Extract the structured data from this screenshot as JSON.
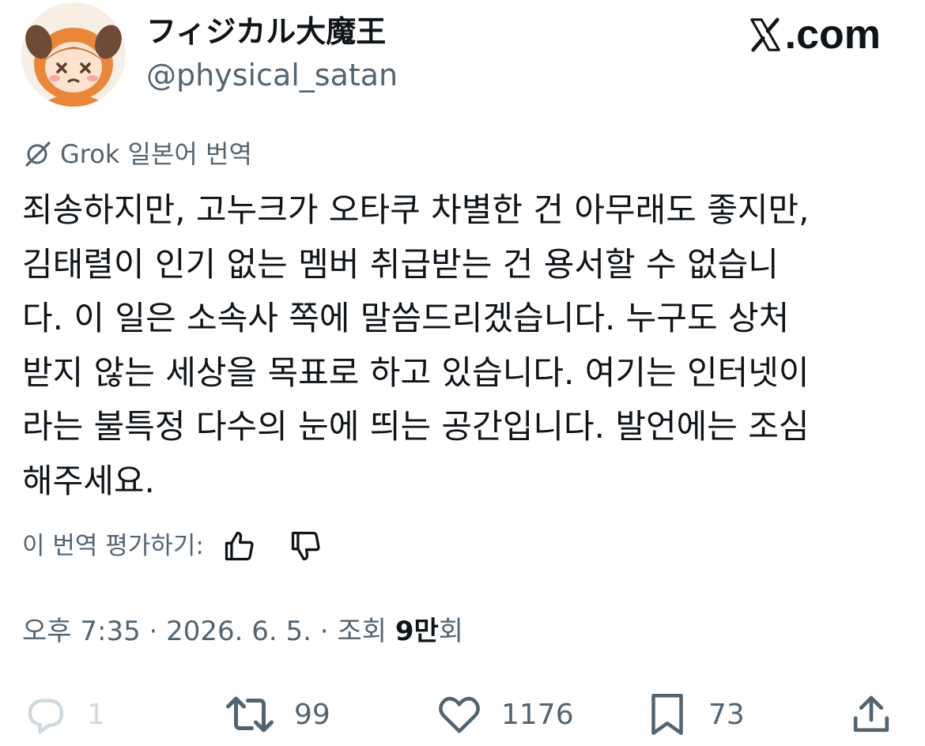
{
  "author": {
    "display_name": "フィジカル大魔王",
    "handle": "@physical_satan"
  },
  "site_logo": {
    "label": ".com",
    "icon": "x-logo-icon"
  },
  "translation": {
    "icon": "grok-icon",
    "label": "Grok 일본어 번역"
  },
  "tweet": {
    "lines": [
      "죄송하지만, 고누크가 오타쿠 차별한 건 아무래도 좋지만,",
      "김태렬이 인기 없는 멤버 취급받는 건 용서할 수 없습니",
      "다. 이 일은 소속사 쪽에 말씀드리겠습니다. 누구도 상처",
      "받지 않는 세상을 목표로 하고 있습니다. 여기는 인터넷이",
      "라는 불특정 다수의 눈에 띄는 공간입니다. 발언에는 조심",
      "해주세요."
    ]
  },
  "rating": {
    "label": "이 번역 평가하기:",
    "up_icon": "thumbs-up-icon",
    "down_icon": "thumbs-down-icon"
  },
  "meta": {
    "time": "오후 7:35",
    "separator1": " · ",
    "date": "2026. 6. 5.",
    "separator2": " · ",
    "views_label": "조회 ",
    "views_count": "9만",
    "views_suffix": "회"
  },
  "actions": {
    "reply": {
      "icon": "reply-icon",
      "count": "1"
    },
    "retweet": {
      "icon": "retweet-icon",
      "count": "99"
    },
    "like": {
      "icon": "heart-icon",
      "count": "1176"
    },
    "bookmark": {
      "icon": "bookmark-icon",
      "count": "73"
    },
    "share": {
      "icon": "share-icon"
    }
  },
  "colors": {
    "text": "#0f1419",
    "secondary": "#536471",
    "muted": "#cfd9de",
    "background": "#ffffff",
    "avatar_orange": "#e8873a"
  }
}
